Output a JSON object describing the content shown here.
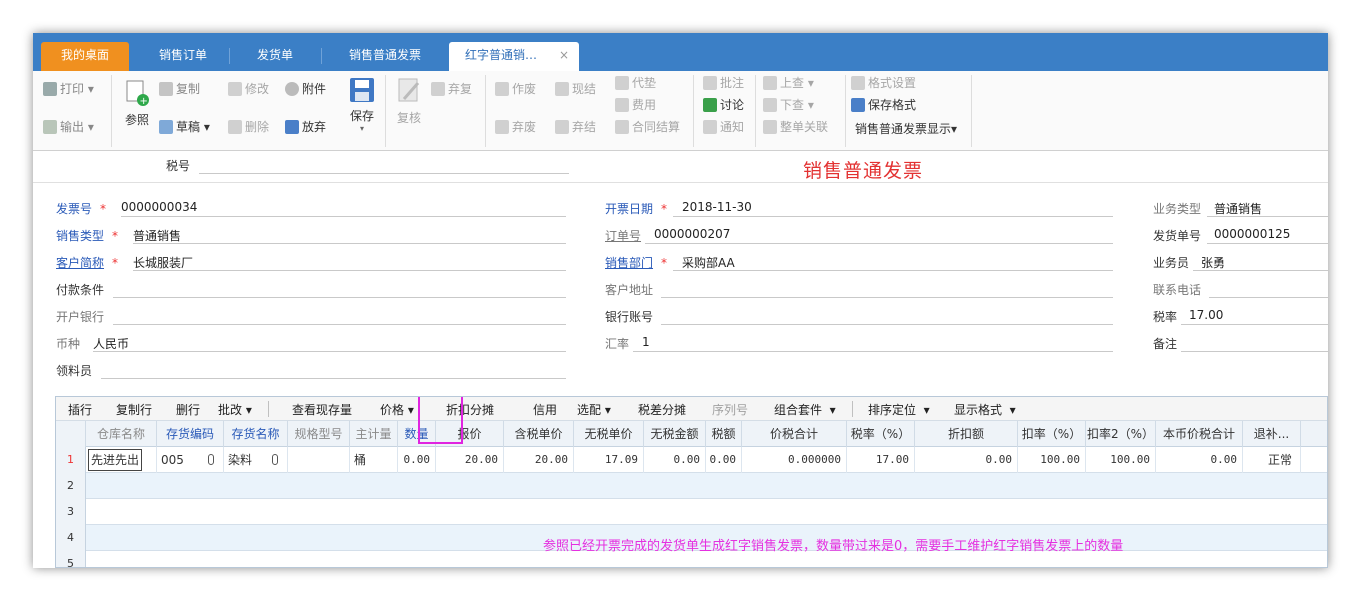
{
  "tabs": [
    {
      "label": "我的桌面"
    },
    {
      "label": "销售订单"
    },
    {
      "label": "发货单"
    },
    {
      "label": "销售普通发票"
    },
    {
      "label": "红字普通销…",
      "close": "×"
    }
  ],
  "toolbar": {
    "print": "打印",
    "export": "输出",
    "reference": "参照",
    "copy": "复制",
    "draft": "草稿",
    "modify": "修改",
    "delete": "删除",
    "attachment": "附件",
    "abandon": "放弃",
    "save": "保存",
    "review": "复核",
    "discard": "弃复",
    "void": "作废",
    "discard2": "弃废",
    "settle_cash": "现结",
    "discard_settle": "弃结",
    "advance": "代垫",
    "expense": "费用",
    "contract_settle": "合同结算",
    "approve": "批注",
    "discuss": "讨论",
    "notify": "通知",
    "prev": "上查",
    "next": "下查",
    "link_all": "整单关联",
    "format_setting": "格式设置",
    "save_format": "保存格式",
    "display_format": "销售普通发票显示"
  },
  "tax_no_label": "税号",
  "form_title": "销售普通发票",
  "header": {
    "invoice_no_label": "发票号",
    "invoice_no": "0000000034",
    "sales_type_label": "销售类型",
    "sales_type": "普通销售",
    "customer_label": "客户简称",
    "customer": "长城服装厂",
    "payment_terms_label": "付款条件",
    "bank_label": "开户银行",
    "currency_label": "币种",
    "currency": "人民币",
    "receiver_label": "领料员",
    "invoice_date_label": "开票日期",
    "invoice_date": "2018-11-30",
    "order_no_label": "订单号",
    "order_no": "0000000207",
    "dept_label": "销售部门",
    "dept": "采购部AA",
    "address_label": "客户地址",
    "bank_account_label": "银行账号",
    "rate_label": "汇率",
    "rate": "1",
    "business_type_label": "业务类型",
    "business_type": "普通销售",
    "delivery_no_label": "发货单号",
    "delivery_no": "0000000125",
    "salesman_label": "业务员",
    "salesman": "张勇",
    "phone_label": "联系电话",
    "tax_rate_label": "税率",
    "tax_rate": "17.00",
    "remark_label": "备注"
  },
  "grid_toolbar": {
    "insert": "插行",
    "copy_row": "复制行",
    "delete_row": "删行",
    "batch": "批改",
    "stock": "查看现存量",
    "price": "价格",
    "discount": "折扣分摊",
    "credit": "信用",
    "options": "选配",
    "tax_diff": "税差分摊",
    "serial": "序列号",
    "kit": "组合套件",
    "sort": "排序定位",
    "display": "显示格式"
  },
  "columns": [
    "仓库名称",
    "存货编码",
    "存货名称",
    "规格型号",
    "主计量",
    "数量",
    "报价",
    "含税单价",
    "无税单价",
    "无税金额",
    "税额",
    "价税合计",
    "税率（%）",
    "折扣额",
    "扣率（%）",
    "扣率2（%）",
    "本币价税合计",
    "退补..."
  ],
  "rows": [
    {
      "no": "1",
      "warehouse": "先进先出",
      "code": "005",
      "name": "染料",
      "spec": "",
      "unit": "桶",
      "qty": "0.00",
      "quote": "20.00",
      "tax_price": "20.00",
      "net_price": "17.09",
      "net_amount": "0.00",
      "tax": "0.00",
      "total": "0.000000",
      "tax_rate": "17.00",
      "discount": "0.00",
      "disc_rate": "100.00",
      "disc_rate2": "100.00",
      "local_total": "0.00",
      "refund": "正常"
    },
    {
      "no": "2"
    },
    {
      "no": "3"
    },
    {
      "no": "4"
    },
    {
      "no": "5"
    }
  ],
  "note": "参照已经开票完成的发货单生成红字销售发票，数量带过来是0，需要手工维护红字销售发票上的数量",
  "colors": {
    "tabbar": "#3b7fc6",
    "home_tab": "#f0901f",
    "title": "#e33232",
    "highlight": "#e024e0"
  }
}
